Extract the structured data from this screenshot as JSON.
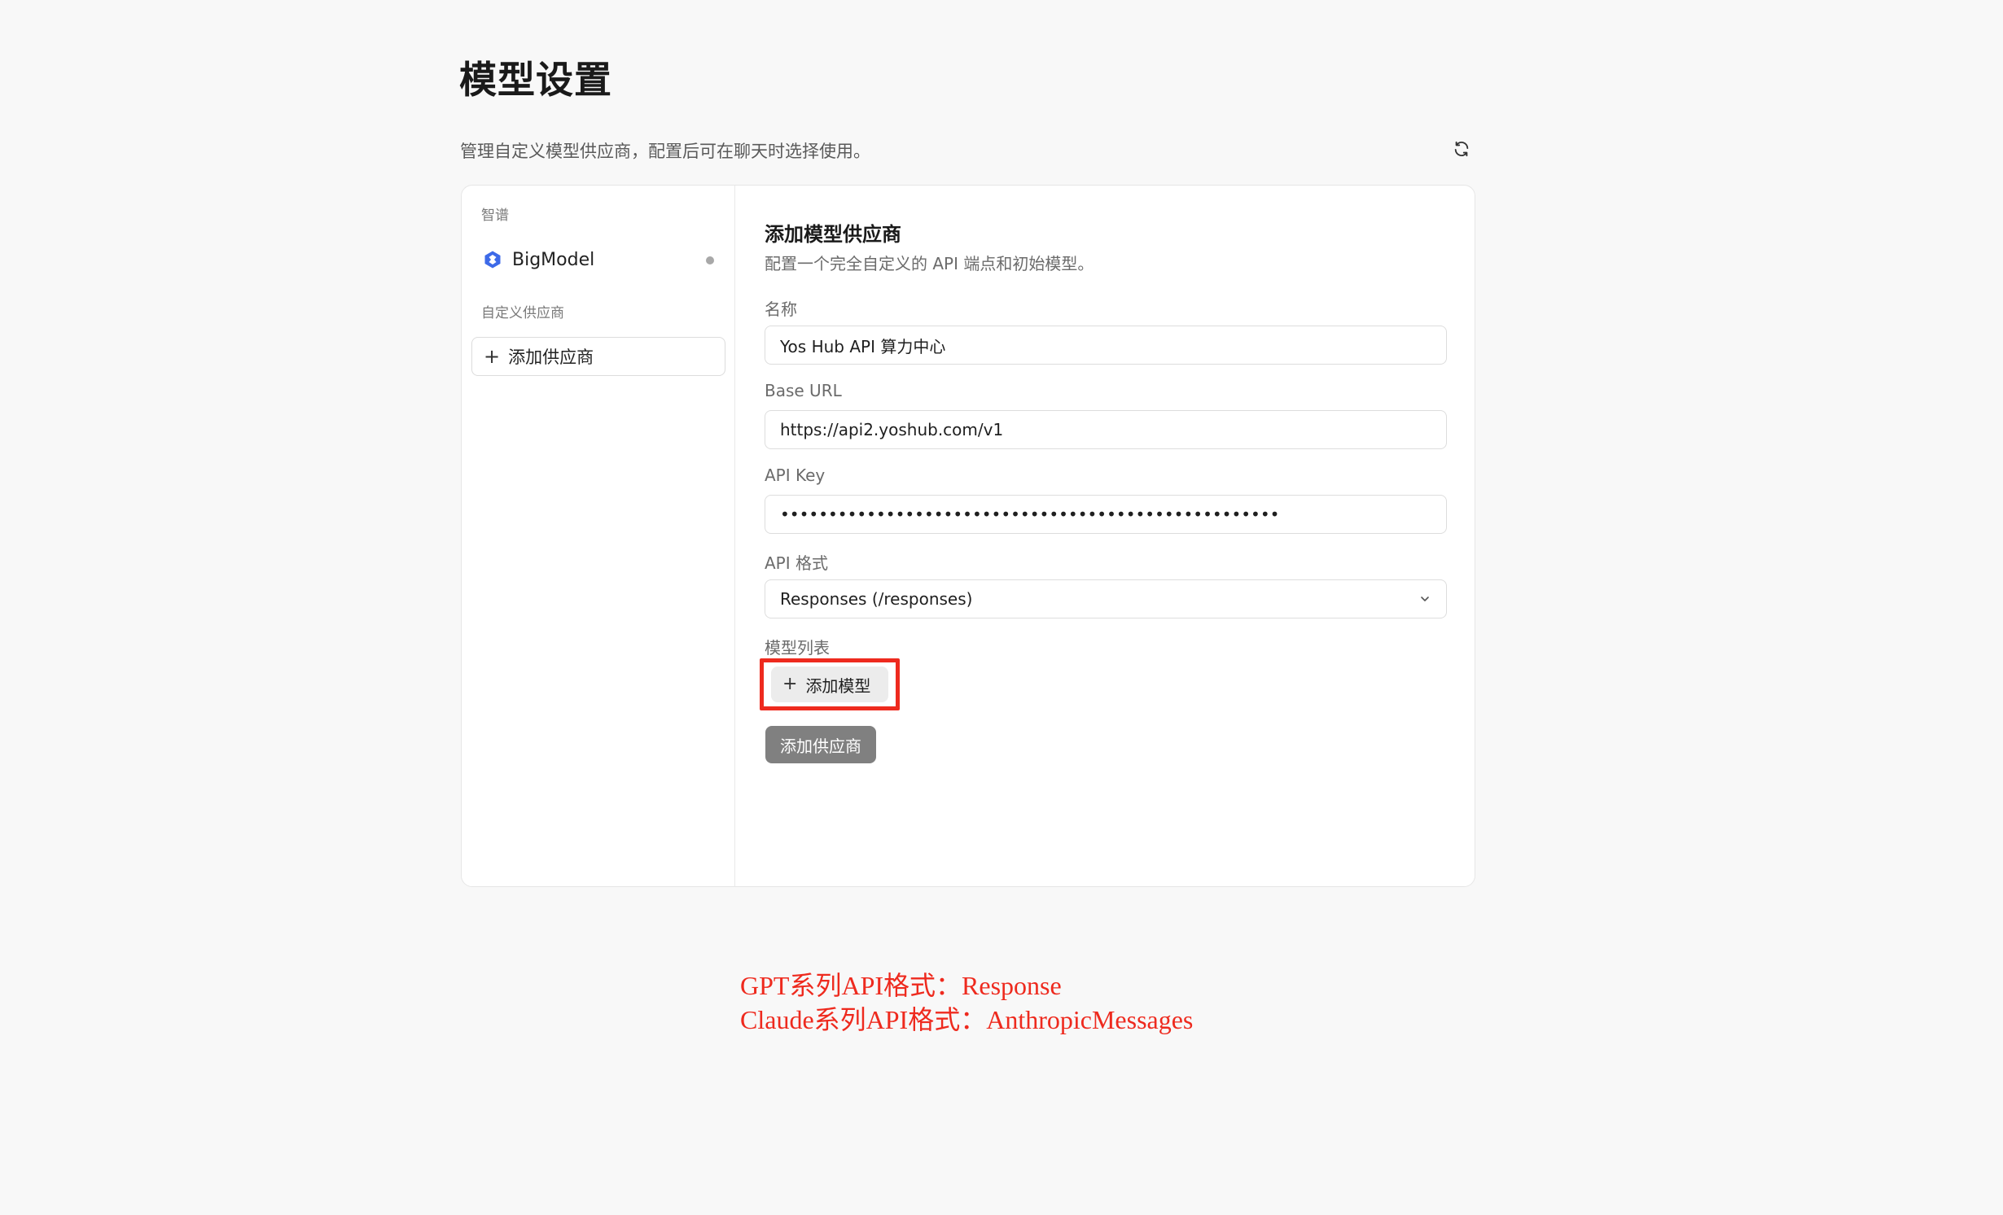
{
  "page": {
    "title": "模型设置",
    "description": "管理自定义模型供应商，配置后可在聊天时选择使用。"
  },
  "sidebar": {
    "section_builtin": "智谱",
    "provider": {
      "label": "BigModel",
      "icon": "bigmodel-logo-icon"
    },
    "section_custom": "自定义供应商",
    "add_provider_label": "添加供应商"
  },
  "form": {
    "title": "添加模型供应商",
    "description": "配置一个完全自定义的 API 端点和初始模型。",
    "name": {
      "label": "名称",
      "value": "Yos Hub API 算力中心"
    },
    "base_url": {
      "label": "Base URL",
      "value": "https://api2.yoshub.com/v1"
    },
    "api_key": {
      "label": "API Key",
      "value": "••••••••••••••••••••••••••••••••••••••••••••••••••••"
    },
    "api_format": {
      "label": "API 格式",
      "selected": "Responses (/responses)"
    },
    "models": {
      "label": "模型列表",
      "add_model_label": "添加模型"
    },
    "submit_label": "添加供应商"
  },
  "annotations": [
    "GPT系列API格式：Response",
    "Claude系列API格式：AnthropicMessages"
  ],
  "colors": {
    "annotation": "#ee2a1e",
    "brand_icon": "#3d6ae8",
    "submit_bg": "#808080"
  }
}
